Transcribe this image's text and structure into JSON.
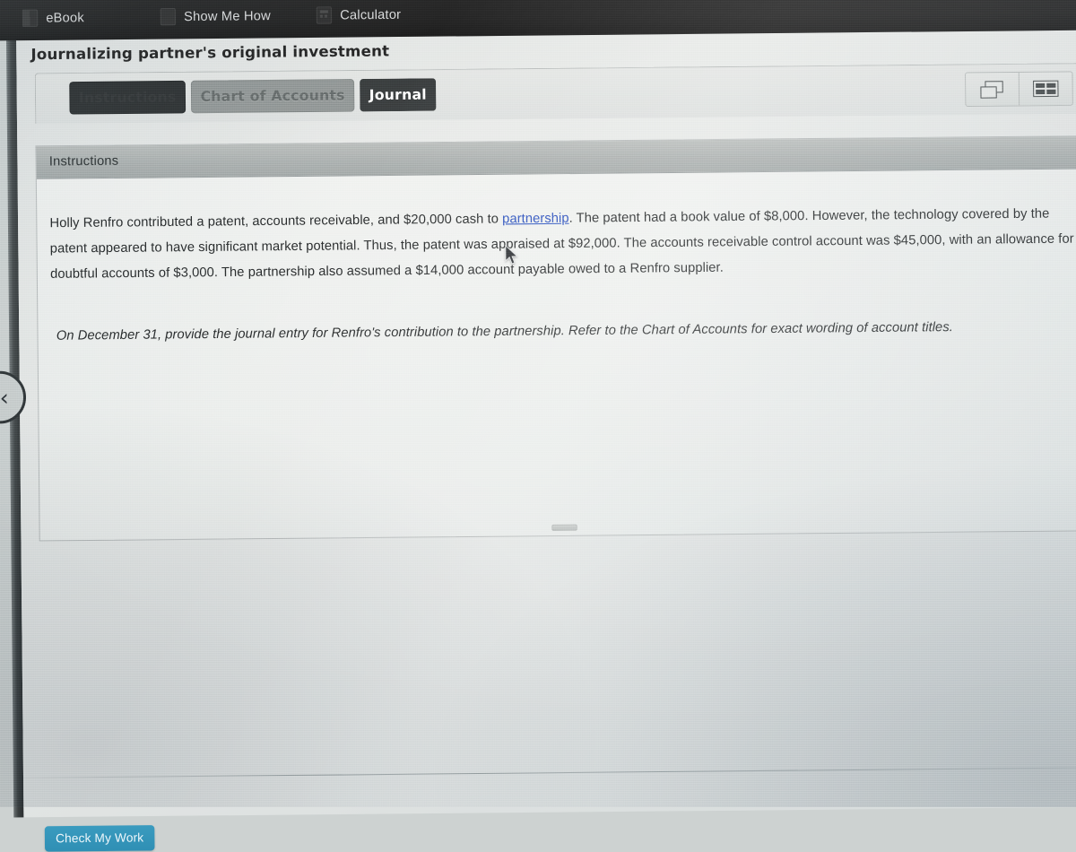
{
  "toolbar": {
    "items": [
      {
        "label": "eBook",
        "icon": "book-icon"
      },
      {
        "label": "Show Me How",
        "icon": "video-icon"
      },
      {
        "label": "Calculator",
        "icon": "calculator-icon"
      }
    ]
  },
  "page": {
    "title": "Journalizing partner's original investment"
  },
  "tabs": [
    {
      "label": "Instructions",
      "state": "dimmed"
    },
    {
      "label": "Chart of Accounts",
      "state": "inactive"
    },
    {
      "label": "Journal",
      "state": "active"
    }
  ],
  "window_controls": [
    {
      "label": "Cascade windows",
      "icon": "cascade-windows-icon"
    },
    {
      "label": "Tile windows",
      "icon": "tile-windows-icon"
    }
  ],
  "panel": {
    "header": "Instructions",
    "paragraph_1": {
      "before_link": "Holly Renfro contributed a patent, accounts receivable, and $20,000 cash to ",
      "link_text": "partnership",
      "after_link": ". The patent had a book value of $8,000. However, the technology covered by the patent appeared to have significant market potential. Thus, the patent was appraised at $92,000. The accounts receivable control account was $45,000, with an allowance for doubtful accounts of $3,000. The partnership also assumed a $14,000 account payable owed to a Renfro supplier."
    },
    "paragraph_2": "On December 31, provide the journal entry for Renfro's contribution to the partnership. Refer to the Chart of Accounts for exact wording of account titles."
  },
  "footer": {
    "check_my_work": "Check My Work"
  },
  "navigation": {
    "prev_label": "‹",
    "prev_name": "previous-page-button"
  },
  "colors": {
    "accent_blue": "#2f8fb4",
    "link_blue": "#1a42b8",
    "active_tab_bg": "#2f3334",
    "inactive_tab_bg": "#8d9291",
    "panel_header_bg": "#a7acab",
    "toolbar_bg": "#1d1d1d"
  }
}
